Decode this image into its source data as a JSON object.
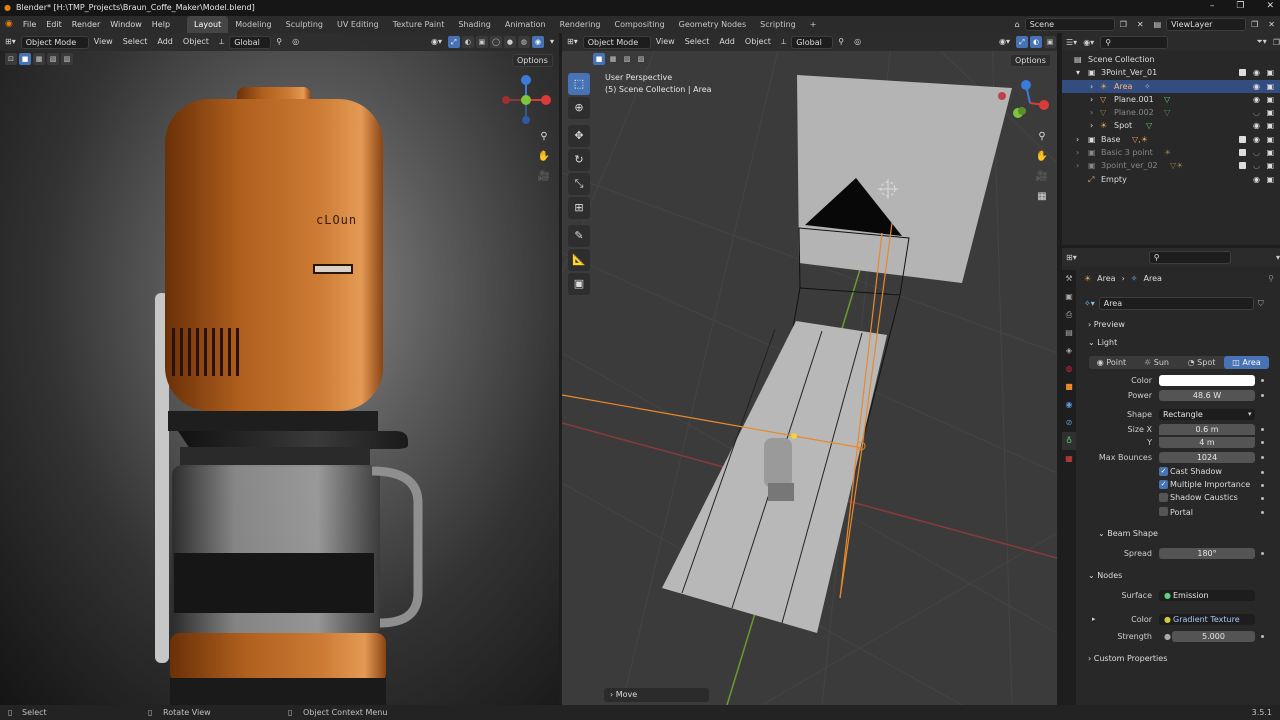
{
  "title": "Blender* [H:\\TMP_Projects\\Braun_Coffe_Maker\\Model.blend]",
  "menus": [
    "File",
    "Edit",
    "Render",
    "Window",
    "Help"
  ],
  "workspaces": [
    "Layout",
    "Modeling",
    "Sculpting",
    "UV Editing",
    "Texture Paint",
    "Shading",
    "Animation",
    "Rendering",
    "Compositing",
    "Geometry Nodes",
    "Scripting",
    "+"
  ],
  "scene": "Scene",
  "view_layer": "ViewLayer",
  "viewport_left": {
    "mode": "Object Mode",
    "menus": [
      "View",
      "Select",
      "Add",
      "Object"
    ],
    "orientation": "Global",
    "options": "Options",
    "brand_text": "cLOun"
  },
  "viewport_right": {
    "mode": "Object Mode",
    "menus": [
      "View",
      "Select",
      "Add",
      "Object"
    ],
    "orientation": "Global",
    "options": "Options",
    "overlay_title": "User Perspective",
    "overlay_sub": "(5) Scene Collection | Area",
    "last_op": "Move"
  },
  "outliner": {
    "root": "Scene Collection",
    "items": [
      {
        "name": "3Point_Ver_01",
        "level": 1,
        "type": "collection"
      },
      {
        "name": "Area",
        "level": 2,
        "type": "light",
        "selected": true
      },
      {
        "name": "Plane.001",
        "level": 2,
        "type": "mesh"
      },
      {
        "name": "Plane.002",
        "level": 2,
        "type": "mesh",
        "dim": true
      },
      {
        "name": "Spot",
        "level": 2,
        "type": "light"
      },
      {
        "name": "Base",
        "level": 1,
        "type": "collection"
      },
      {
        "name": "Basic 3 point",
        "level": 1,
        "type": "collection",
        "dim": true
      },
      {
        "name": "3point_ver_02",
        "level": 1,
        "type": "collection",
        "dim": true
      },
      {
        "name": "Empty",
        "level": 1,
        "type": "empty"
      }
    ]
  },
  "properties": {
    "breadcrumb": [
      "Area",
      "Area"
    ],
    "datablock": "Area",
    "preview": "Preview",
    "light_section": "Light",
    "light_types": [
      "Point",
      "Sun",
      "Spot",
      "Area"
    ],
    "active_type": "Area",
    "color_label": "Color",
    "color_value": "#ffffff",
    "power_label": "Power",
    "power": "48.6 W",
    "shape_label": "Shape",
    "shape": "Rectangle",
    "sizex_label": "Size X",
    "sizex": "0.6 m",
    "y_label": "Y",
    "y": "4 m",
    "bounces_label": "Max Bounces",
    "bounces": "1024",
    "cast_shadow": "Cast Shadow",
    "multiple_importance": "Multiple Importance",
    "shadow_caustics": "Shadow Caustics",
    "portal": "Portal",
    "beam_shape": "Beam Shape",
    "spread_label": "Spread",
    "spread": "180°",
    "nodes": "Nodes",
    "surface_label": "Surface",
    "surface": "Emission",
    "ncolor_label": "Color",
    "ncolor": "Gradient Texture",
    "strength_label": "Strength",
    "strength": "5.000",
    "custom": "Custom Properties"
  },
  "status": {
    "select": "Select",
    "rotate": "Rotate View",
    "context": "Object Context Menu",
    "version": "3.5.1"
  }
}
